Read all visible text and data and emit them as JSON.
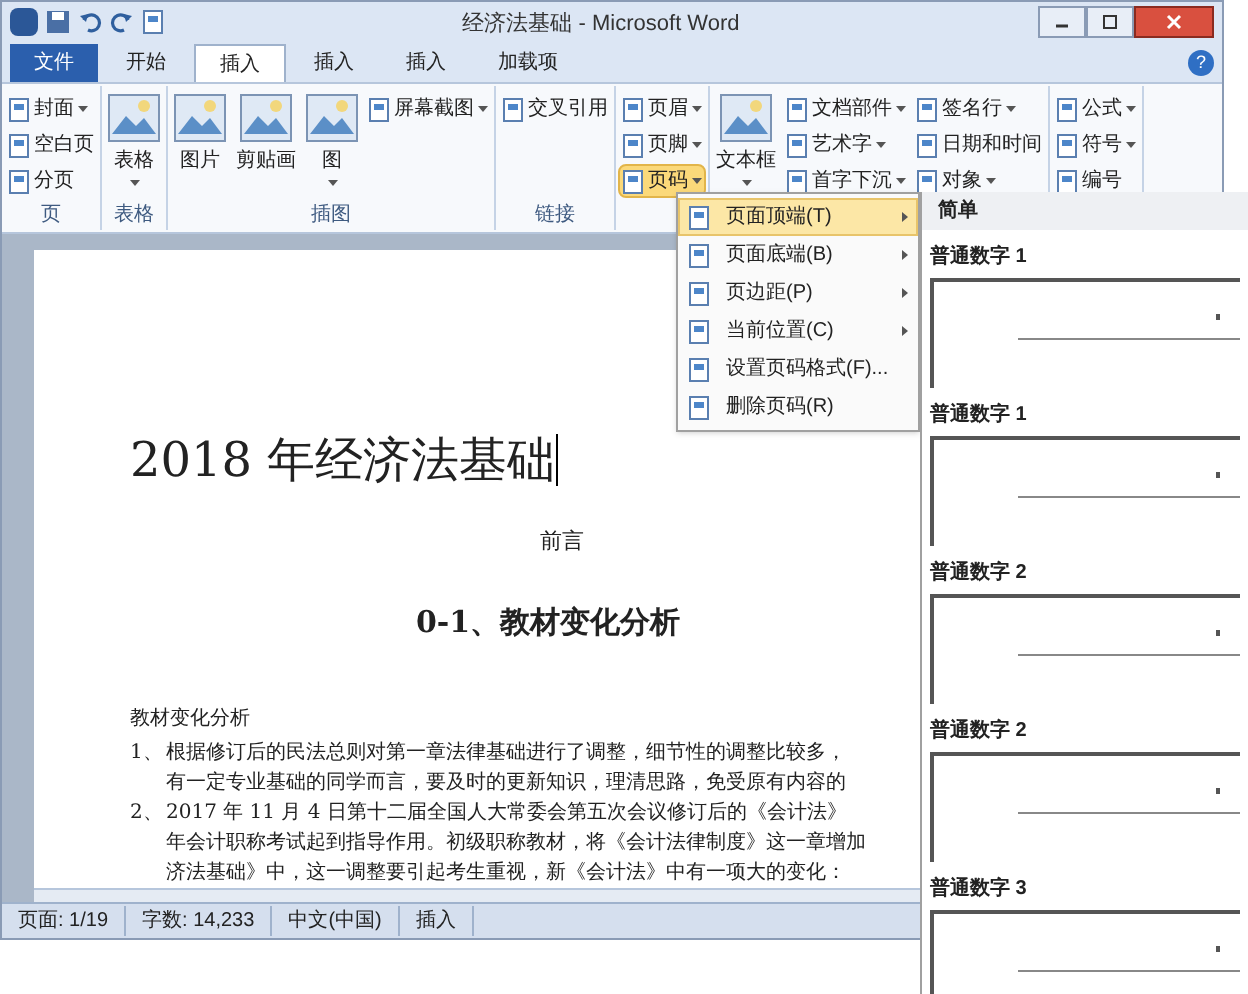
{
  "window": {
    "title": "经济法基础 - Microsoft Word"
  },
  "tabs": [
    {
      "label": "文件",
      "selected": false,
      "kind": "file"
    },
    {
      "label": "开始",
      "selected": false,
      "kind": "tab"
    },
    {
      "label": "插入",
      "selected": true,
      "kind": "tab"
    },
    {
      "label": "插入",
      "selected": false,
      "kind": "tab"
    },
    {
      "label": "插入",
      "selected": false,
      "kind": "tab"
    },
    {
      "label": "加载项",
      "selected": false,
      "kind": "tab"
    }
  ],
  "ribbon": [
    {
      "label": "页",
      "buttons": [
        {
          "label": "封面",
          "kind": "small",
          "dropdown": true,
          "pressed": false
        },
        {
          "label": "空白页",
          "kind": "small",
          "dropdown": false,
          "pressed": false
        },
        {
          "label": "分页",
          "kind": "small",
          "dropdown": false,
          "pressed": false
        }
      ]
    },
    {
      "label": "表格",
      "buttons": [
        {
          "label": "表格",
          "kind": "large",
          "dropdown": true,
          "pressed": false
        }
      ]
    },
    {
      "label": "插图",
      "buttons": [
        {
          "label": "图片",
          "kind": "large",
          "dropdown": false,
          "pressed": false
        },
        {
          "label": "剪贴画",
          "kind": "large",
          "dropdown": false,
          "pressed": false
        },
        {
          "label": "图",
          "kind": "large",
          "dropdown": true,
          "pressed": false
        },
        {
          "label": "屏幕截图",
          "kind": "small",
          "dropdown": true,
          "pressed": false
        }
      ]
    },
    {
      "label": "链接",
      "buttons": [
        {
          "label": "交叉引用",
          "kind": "small",
          "dropdown": false,
          "pressed": false
        }
      ]
    },
    {
      "buttons": [
        {
          "label": "页眉",
          "kind": "small",
          "dropdown": true,
          "pressed": false
        },
        {
          "label": "页脚",
          "kind": "small",
          "dropdown": true,
          "pressed": false
        },
        {
          "label": "页码",
          "kind": "small",
          "dropdown": true,
          "pressed": true
        }
      ]
    },
    {
      "buttons": [
        {
          "label": "文本框",
          "kind": "large",
          "dropdown": true,
          "pressed": false
        },
        {
          "label": "文档部件",
          "kind": "small",
          "dropdown": true,
          "pressed": false
        },
        {
          "label": "艺术字",
          "kind": "small",
          "dropdown": true,
          "pressed": false
        },
        {
          "label": "首字下沉",
          "kind": "small",
          "dropdown": true,
          "pressed": false
        },
        {
          "label": "签名行",
          "kind": "small",
          "dropdown": true,
          "pressed": false
        },
        {
          "label": "日期和时间",
          "kind": "small",
          "dropdown": false,
          "pressed": false
        },
        {
          "label": "对象",
          "kind": "small",
          "dropdown": true,
          "pressed": false
        }
      ]
    },
    {
      "buttons": [
        {
          "label": "公式",
          "kind": "small",
          "dropdown": true,
          "pressed": false
        },
        {
          "label": "符号",
          "kind": "small",
          "dropdown": true,
          "pressed": false
        },
        {
          "label": "编号",
          "kind": "small",
          "dropdown": false,
          "pressed": false
        }
      ]
    }
  ],
  "page_number_menu": [
    {
      "label": "页面顶端(T)",
      "submenu": true,
      "selected": true
    },
    {
      "label": "页面底端(B)",
      "submenu": true,
      "selected": false
    },
    {
      "label": "页边距(P)",
      "submenu": true,
      "selected": false
    },
    {
      "label": "当前位置(C)",
      "submenu": true,
      "selected": false
    },
    {
      "label": "设置页码格式(F)...",
      "submenu": false,
      "selected": false
    },
    {
      "label": "删除页码(R)",
      "submenu": false,
      "selected": false
    }
  ],
  "gallery": {
    "header": "简单",
    "items": [
      "普通数字 1",
      "普通数字 1",
      "普通数字 2",
      "普通数字 2",
      "普通数字 3"
    ]
  },
  "document": {
    "title": "2018 年经济法基础",
    "subtitle": "前言",
    "heading": "0-1、教材变化分析",
    "section": "教材变化分析",
    "list": [
      {
        "number": "1、",
        "lines": [
          "根据修订后的民法总则对第一章法律基础进行了调整，细节性的调整比较多，",
          "有一定专业基础的同学而言，要及时的更新知识，理清思路，免受原有内容的"
        ]
      },
      {
        "number": "2、",
        "lines": [
          "2017 年 11 月 4 日第十二届全国人大常委会第五次会议修订后的《会计法》",
          "年会计职称考试起到指导作用。初级职称教材，将《会计法律制度》这一章增加",
          "济法基础》中，这一调整要引起考生重视，新《会计法》中有一项大的变化："
        ]
      }
    ]
  },
  "help_button": "?",
  "status_bar": [
    "页面: 1/19",
    "字数: 14,233",
    "中文(中国)",
    "插入"
  ]
}
